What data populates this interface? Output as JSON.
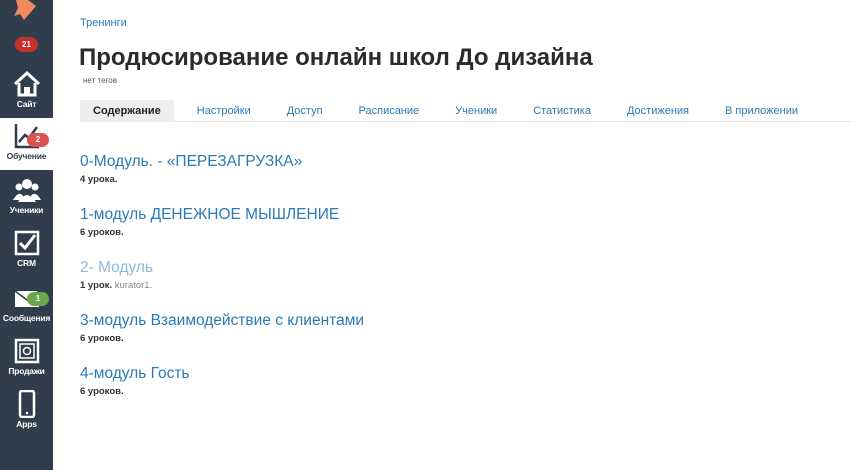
{
  "sidebar": {
    "top_badge": "21",
    "items": [
      {
        "label": "Сайт",
        "icon": "home-icon",
        "badge": null
      },
      {
        "label": "Обучение",
        "icon": "chart-icon",
        "badge": "2"
      },
      {
        "label": "Ученики",
        "icon": "users-icon",
        "badge": null
      },
      {
        "label": "CRM",
        "icon": "checkbox-icon",
        "badge": null
      },
      {
        "label": "Сообщения",
        "icon": "envelope-icon",
        "badge": "1"
      },
      {
        "label": "Продажи",
        "icon": "safe-icon",
        "badge": null
      },
      {
        "label": "Apps",
        "icon": "phone-icon",
        "badge": null
      }
    ]
  },
  "breadcrumb": "Тренинги",
  "title": "Продюсирование онлайн школ До дизайна",
  "tags": "нет тегов",
  "tabs": [
    {
      "label": "Содержание",
      "active": true
    },
    {
      "label": "Настройки",
      "active": false
    },
    {
      "label": "Доступ",
      "active": false
    },
    {
      "label": "Расписание",
      "active": false
    },
    {
      "label": "Ученики",
      "active": false
    },
    {
      "label": "Статистика",
      "active": false
    },
    {
      "label": "Достижения",
      "active": false
    },
    {
      "label": "В приложении",
      "active": false
    }
  ],
  "modules": [
    {
      "title": "0-Модуль. - «ПЕРЕЗАГРУЗКА»",
      "count": "4 урока.",
      "curator": "",
      "disabled": false
    },
    {
      "title": "1-модуль ДЕНЕЖНОЕ МЫШЛЕНИЕ",
      "count": "6 уроков.",
      "curator": "",
      "disabled": false
    },
    {
      "title": "2- Модуль",
      "count": "1 урок.",
      "curator": "kurator1.",
      "disabled": true
    },
    {
      "title": "3-модуль Взаимодействие с клиентами",
      "count": "6 уроков.",
      "curator": "",
      "disabled": false
    },
    {
      "title": "4-модуль Гость",
      "count": "6 уроков.",
      "curator": "",
      "disabled": false
    }
  ],
  "colors": {
    "sidebar_bg": "#2f3d4c",
    "link": "#2a7ab8",
    "logo": "#f08a5d",
    "badge_red": "#d9534f",
    "badge_green": "#6aa84f"
  }
}
